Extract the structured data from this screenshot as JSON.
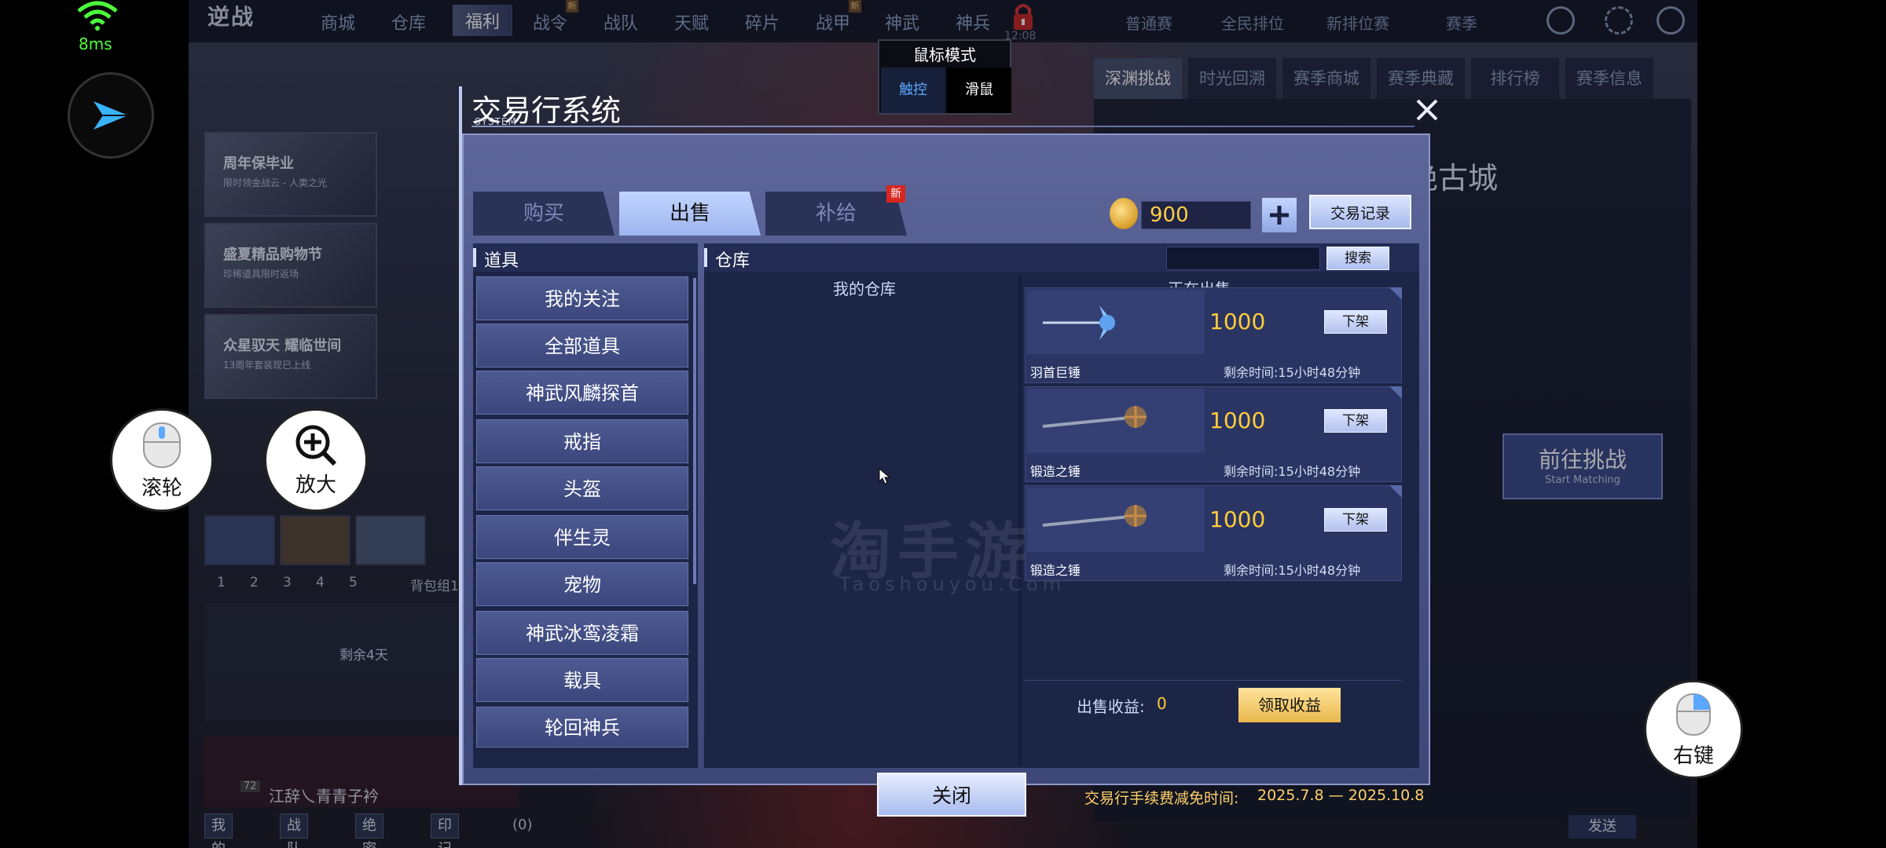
{
  "status": {
    "ping": "8ms",
    "clock": "12:08"
  },
  "topnav": {
    "logo": "逆战",
    "items": [
      "商城",
      "仓库",
      "福利",
      "战令",
      "战队",
      "天赋",
      "碎片",
      "战甲",
      "神武",
      "神兵"
    ],
    "right_items": [
      "普通赛",
      "全民排位",
      "新排位赛",
      "赛季"
    ]
  },
  "mouse_mode": {
    "title": "鼠标模式",
    "touch": "触控",
    "mouse": "滑鼠"
  },
  "activity": {
    "cards": [
      {
        "title": "周年保毕业",
        "sub": "限时领金战云 - 人类之光"
      },
      {
        "title": "盛夏精品购物节",
        "sub": "珍稀道具限时返场"
      },
      {
        "title": "众星驭天 耀临世间",
        "sub": "13周年套装现已上线"
      }
    ]
  },
  "loadout": {
    "slots": [
      "1",
      "2",
      "3",
      "4",
      "5"
    ],
    "group": "背包组1",
    "remain": "剩余4天"
  },
  "chat": {
    "player": "江辞乀青青子衿",
    "level": "72",
    "buttons": [
      "我的好友",
      "战队成员",
      "绝密档案",
      "印记图鉴"
    ],
    "mail": "(0)"
  },
  "right_panel": {
    "tabs": [
      "深渊挑战",
      "时光回溯",
      "赛季商城",
      "赛季典藏",
      "排行榜",
      "赛季信息"
    ],
    "map_name": "绝古城",
    "start": "前往挑战",
    "start_en": "Start Matching",
    "send": "发送"
  },
  "dialog": {
    "title": "交易行系统",
    "subtitle": "SYSTEM",
    "tabs": [
      "购买",
      "出售",
      "补给"
    ],
    "active_tab": "出售",
    "new_badge": "新",
    "coins": "900",
    "record_btn": "交易记录",
    "left_header": "道具",
    "categories": [
      "我的关注",
      "全部道具",
      "神武风麟探首",
      "戒指",
      "头盔",
      "伴生灵",
      "宠物",
      "神武冰鸾凌霜",
      "载具",
      "轮回神兵"
    ],
    "right_header": "仓库",
    "search_placeholder": "",
    "search_btn": "搜索",
    "col_warehouse": "我的仓库",
    "col_selling": "正在出售",
    "listings": [
      {
        "name": "羽首巨锤",
        "price": "1000",
        "remaining": "剩余时间:15小时48分钟",
        "btn": "下架"
      },
      {
        "name": "锻造之锤",
        "price": "1000",
        "remaining": "剩余时间:15小时48分钟",
        "btn": "下架"
      },
      {
        "name": "锻造之锤",
        "price": "1000",
        "remaining": "剩余时间:15小时48分钟",
        "btn": "下架"
      }
    ],
    "income_label": "出售收益:",
    "income_value": "0",
    "claim_btn": "领取收益",
    "close_btn": "关闭",
    "fee_label": "交易行手续费减免时间:",
    "fee_period": "2025.7.8 — 2025.10.8",
    "watermark": "淘手游",
    "watermark_en": "Taoshouyou.Com"
  },
  "controls": {
    "scroll": "滚轮",
    "zoom": "放大",
    "right_click": "右键"
  }
}
